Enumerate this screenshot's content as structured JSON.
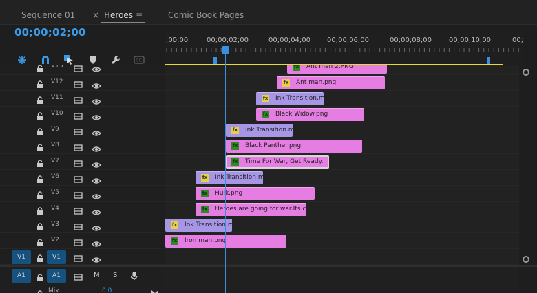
{
  "tabs": [
    {
      "label": "Sequence 01"
    },
    {
      "label": "Heroes",
      "close": "×",
      "menu": "≡"
    },
    {
      "label": "Comic Book Pages"
    }
  ],
  "timecode": "00;00;02;00",
  "ruler_labels": [
    ";00;00",
    "00;00;02;00",
    "00;00;04;00",
    "00;00;06;00",
    "00;00;08;00",
    "00;00;10;00",
    "00;"
  ],
  "tracks": [
    {
      "name": "V13"
    },
    {
      "name": "V12"
    },
    {
      "name": "V11"
    },
    {
      "name": "V10"
    },
    {
      "name": "V9"
    },
    {
      "name": "V8"
    },
    {
      "name": "V7"
    },
    {
      "name": "V6"
    },
    {
      "name": "V5"
    },
    {
      "name": "V4"
    },
    {
      "name": "V3"
    },
    {
      "name": "V2"
    },
    {
      "name": "V1",
      "source": "V1"
    }
  ],
  "audio": {
    "source": "A1",
    "name": "A1",
    "mute": "M",
    "solo": "S",
    "mix_label": "Mix",
    "mix_value": "0.0"
  },
  "clips": [
    {
      "label": "Ant man 2.PNG",
      "kind": "pink",
      "fx": "green"
    },
    {
      "label": "Ant man.png",
      "kind": "pink",
      "fx": "yellow"
    },
    {
      "label": "Ink Transition.m",
      "kind": "purple",
      "fx": "yellow"
    },
    {
      "label": "Black Widow.png",
      "kind": "pink",
      "fx": "green"
    },
    {
      "label": "Ink Transition.m",
      "kind": "purple",
      "fx": "yellow"
    },
    {
      "label": "Black Panther.png",
      "kind": "pink",
      "fx": "green"
    },
    {
      "label": "Time For War, Get Ready.",
      "kind": "pink",
      "fx": "green",
      "selected": true
    },
    {
      "label": "Ink Transition.m",
      "kind": "purple",
      "fx": "yellow"
    },
    {
      "label": "Hulk.png",
      "kind": "pink",
      "fx": "green"
    },
    {
      "label": "Heroes are going for war.Its com",
      "kind": "pink",
      "fx": "green"
    },
    {
      "label": "Ink Transition.m",
      "kind": "purple",
      "fx": "yellow"
    },
    {
      "label": "Iron man.png",
      "kind": "pink",
      "fx": "green"
    }
  ],
  "fx_glyph": "fx",
  "colors": {
    "accent": "#3b8fe0",
    "clip_pink": "#e67de3",
    "clip_purple": "#a796e6",
    "work_area": "#e6dc29",
    "source_patch": "#15527f"
  }
}
